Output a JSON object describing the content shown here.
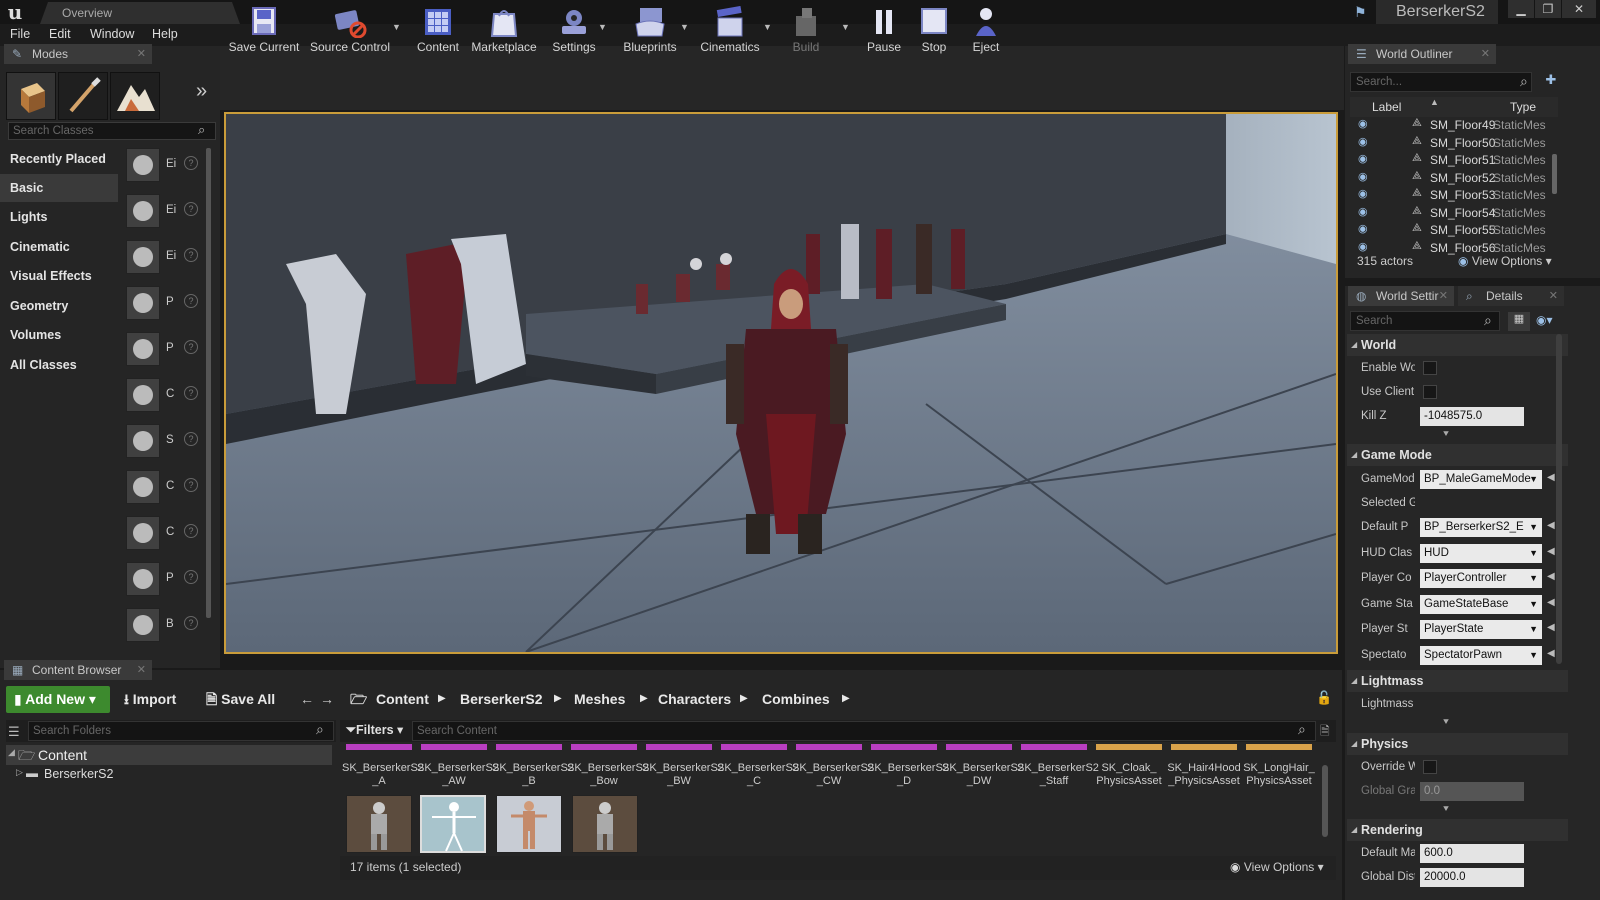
{
  "window": {
    "tab_title": "Overview",
    "project_name": "BerserkerS2",
    "controls": {
      "minimize": "▁",
      "maximize": "❐",
      "close": "✕"
    }
  },
  "menu": [
    "File",
    "Edit",
    "Window",
    "Help"
  ],
  "modes": {
    "title": "Modes",
    "search_placeholder": "Search Classes",
    "categories": [
      "Recently Placed",
      "Basic",
      "Lights",
      "Cinematic",
      "Visual Effects",
      "Geometry",
      "Volumes",
      "All Classes"
    ],
    "selected_category": "Basic",
    "items": [
      {
        "label": "Ei",
        "icon": "empty-actor-sphere-icon"
      },
      {
        "label": "Ei",
        "icon": "empty-character-icon"
      },
      {
        "label": "Ei",
        "icon": "empty-pawn-icon"
      },
      {
        "label": "P",
        "icon": "point-light-icon"
      },
      {
        "label": "P",
        "icon": "player-start-icon"
      },
      {
        "label": "C",
        "icon": "cube-icon"
      },
      {
        "label": "S",
        "icon": "sphere-icon"
      },
      {
        "label": "C",
        "icon": "cylinder-icon"
      },
      {
        "label": "C",
        "icon": "cone-icon"
      },
      {
        "label": "P",
        "icon": "plane-icon"
      },
      {
        "label": "B",
        "icon": "box-trigger-icon"
      }
    ]
  },
  "toolbar": [
    {
      "label": "Save Current",
      "icon": "save-icon",
      "dropdown": false
    },
    {
      "label": "Source Control",
      "icon": "source-control-icon",
      "dropdown": true
    },
    {
      "label": "Content",
      "icon": "content-icon",
      "dropdown": false
    },
    {
      "label": "Marketplace",
      "icon": "marketplace-icon",
      "dropdown": false
    },
    {
      "label": "Settings",
      "icon": "settings-icon",
      "dropdown": true
    },
    {
      "label": "Blueprints",
      "icon": "blueprints-icon",
      "dropdown": true
    },
    {
      "label": "Cinematics",
      "icon": "cinematics-icon",
      "dropdown": true
    },
    {
      "label": "Build",
      "icon": "build-icon",
      "dropdown": true
    },
    {
      "label": "Pause",
      "icon": "pause-icon",
      "dropdown": false
    },
    {
      "label": "Stop",
      "icon": "stop-icon",
      "dropdown": false
    },
    {
      "label": "Eject",
      "icon": "eject-icon",
      "dropdown": false
    }
  ],
  "outliner": {
    "title": "World Outliner",
    "search_placeholder": "Search...",
    "col_label": "Label",
    "col_type": "Type",
    "rows": [
      {
        "name": "SM_Floor49",
        "type": "StaticMes"
      },
      {
        "name": "SM_Floor50",
        "type": "StaticMes"
      },
      {
        "name": "SM_Floor51",
        "type": "StaticMes"
      },
      {
        "name": "SM_Floor52",
        "type": "StaticMes"
      },
      {
        "name": "SM_Floor53",
        "type": "StaticMes"
      },
      {
        "name": "SM_Floor54",
        "type": "StaticMes"
      },
      {
        "name": "SM_Floor55",
        "type": "StaticMes"
      },
      {
        "name": "SM_Floor56",
        "type": "StaticMes"
      }
    ],
    "actor_count": "315 actors",
    "view_options": "View Options"
  },
  "details": {
    "tab_world": "World Settir",
    "tab_details": "Details",
    "search_placeholder": "Search",
    "sections": {
      "world": "World",
      "game_mode": "Game Mode",
      "lightmass": "Lightmass",
      "physics": "Physics",
      "rendering": "Rendering"
    },
    "props": {
      "enable_world": "Enable Worl",
      "use_client": "Use Client S",
      "kill_z": "Kill Z",
      "kill_z_val": "-1048575.0",
      "gamemode": "GameMode",
      "gamemode_val": "BP_MaleGameMode",
      "selected_g": "Selected G",
      "default_p": "Default P",
      "default_p_val": "BP_BerserkerS2_E",
      "hud_class": "HUD Clas",
      "hud_val": "HUD",
      "player_c": "Player Co",
      "player_c_val": "PlayerController",
      "game_state": "Game Sta",
      "game_state_val": "GameStateBase",
      "player_state": "Player St",
      "player_state_val": "PlayerState",
      "spectator": "Spectato",
      "spectator_val": "SpectatorPawn",
      "lightmass_sub": "Lightmass",
      "override_w": "Override W",
      "global_grav": "Global Grav",
      "global_grav_val": "0.0",
      "default_max": "Default Max",
      "default_max_val": "600.0",
      "global_dist": "Global Dist",
      "global_dist_val": "20000.0"
    }
  },
  "content_browser": {
    "title": "Content Browser",
    "add_new": "Add New",
    "import": "Import",
    "save_all": "Save All",
    "breadcrumb": [
      "Content",
      "BerserkerS2",
      "Meshes",
      "Characters",
      "Combines"
    ],
    "search_folders": "Search Folders",
    "filters": "Filters",
    "search_content": "Search Content",
    "tree": {
      "root": "Content",
      "child": "BerserkerS2"
    },
    "assets": [
      {
        "l1": "SK_BerserkerS2",
        "l2": "_A",
        "strip": "#b83ec0"
      },
      {
        "l1": "SK_BerserkerS2",
        "l2": "_AW",
        "strip": "#b83ec0"
      },
      {
        "l1": "SK_BerserkerS2",
        "l2": "_B",
        "strip": "#b83ec0"
      },
      {
        "l1": "SK_BerserkerS2",
        "l2": "_Bow",
        "strip": "#b83ec0"
      },
      {
        "l1": "SK_BerserkerS2",
        "l2": "_BW",
        "strip": "#b83ec0"
      },
      {
        "l1": "SK_BerserkerS2",
        "l2": "_C",
        "strip": "#b83ec0"
      },
      {
        "l1": "SK_BerserkerS2",
        "l2": "_CW",
        "strip": "#b83ec0"
      },
      {
        "l1": "SK_BerserkerS2",
        "l2": "_D",
        "strip": "#b83ec0"
      },
      {
        "l1": "SK_BerserkerS2",
        "l2": "_DW",
        "strip": "#b83ec0"
      },
      {
        "l1": "SK_BerserkerS2",
        "l2": "_Staff",
        "strip": "#b83ec0"
      },
      {
        "l1": "SK_Cloak_",
        "l2": "PhysicsAsset",
        "strip": "#d9a24a"
      },
      {
        "l1": "SK_Hair4Hood",
        "l2": "_PhysicsAsset",
        "strip": "#d9a24a"
      },
      {
        "l1": "SK_LongHair_",
        "l2": "PhysicsAsset",
        "strip": "#d9a24a"
      }
    ],
    "status": "17 items (1 selected)",
    "view_options": "View Options"
  },
  "colors": {
    "viewport_border": "#c99c3a",
    "add_new_green": "#3d8a2e",
    "skeletal_mesh": "#b83ec0",
    "physics_asset": "#d9a24a"
  }
}
